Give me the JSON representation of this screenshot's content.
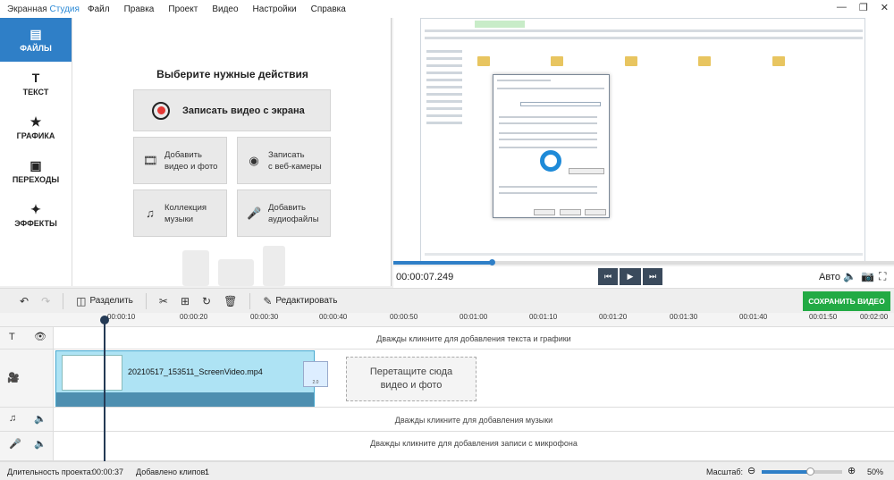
{
  "app": {
    "brand_main": "Экранная",
    "brand_accent": "Студия"
  },
  "menu": [
    "Файл",
    "Правка",
    "Проект",
    "Видео",
    "Настройки",
    "Справка"
  ],
  "nav": [
    {
      "label": "ФАЙЛЫ",
      "icon": "folder-icon",
      "active": true
    },
    {
      "label": "ТЕКСТ",
      "icon": "text-icon"
    },
    {
      "label": "ГРАФИКА",
      "icon": "star-icon"
    },
    {
      "label": "ПЕРЕХОДЫ",
      "icon": "transitions-icon"
    },
    {
      "label": "ЭФФЕКТЫ",
      "icon": "magic-wand-icon"
    }
  ],
  "actions": {
    "title": "Выберите нужные действия",
    "record": "Записать видео с экрана",
    "add_video": [
      "Добавить",
      "видео и фото"
    ],
    "webcam": [
      "Записать",
      "с веб-камеры"
    ],
    "music": [
      "Коллекция",
      "музыки"
    ],
    "audio": [
      "Добавить",
      "аудиофайлы"
    ]
  },
  "player": {
    "timecode": "00:00:07.249",
    "quality": "Авто",
    "progress": 0.2
  },
  "toolbar": {
    "split": "Разделить",
    "edit": "Редактировать",
    "save": "СОХРАНИТЬ ВИДЕО"
  },
  "ruler": [
    "00:00:10",
    "00:00:20",
    "00:00:30",
    "00:00:40",
    "00:00:50",
    "00:01:00",
    "00:01:10",
    "00:01:20",
    "00:01:30",
    "00:01:40",
    "00:01:50",
    "00:02:00"
  ],
  "tracks": {
    "text_hint": "Дважды кликните для добавления текста и графики",
    "clip_name": "20210517_153511_ScreenVideo.mp4",
    "transition_value": "2.0",
    "drop_line1": "Перетащите сюда",
    "drop_line2": "видео и фото",
    "music_hint": "Дважды кликните для добавления музыки",
    "mic_hint": "Дважды кликните для добавления записи с микрофона"
  },
  "status": {
    "duration_label": "Длительность проекта:",
    "duration": "00:00:37",
    "clips_label": "Добавлено клипов:",
    "clips": "1",
    "zoom_label": "Масштаб:",
    "zoom": "50%",
    "zoom_level": 0.5
  },
  "colors": {
    "accent": "#2f7fc7",
    "save": "#22aa44",
    "clip": "#aee3f4"
  }
}
